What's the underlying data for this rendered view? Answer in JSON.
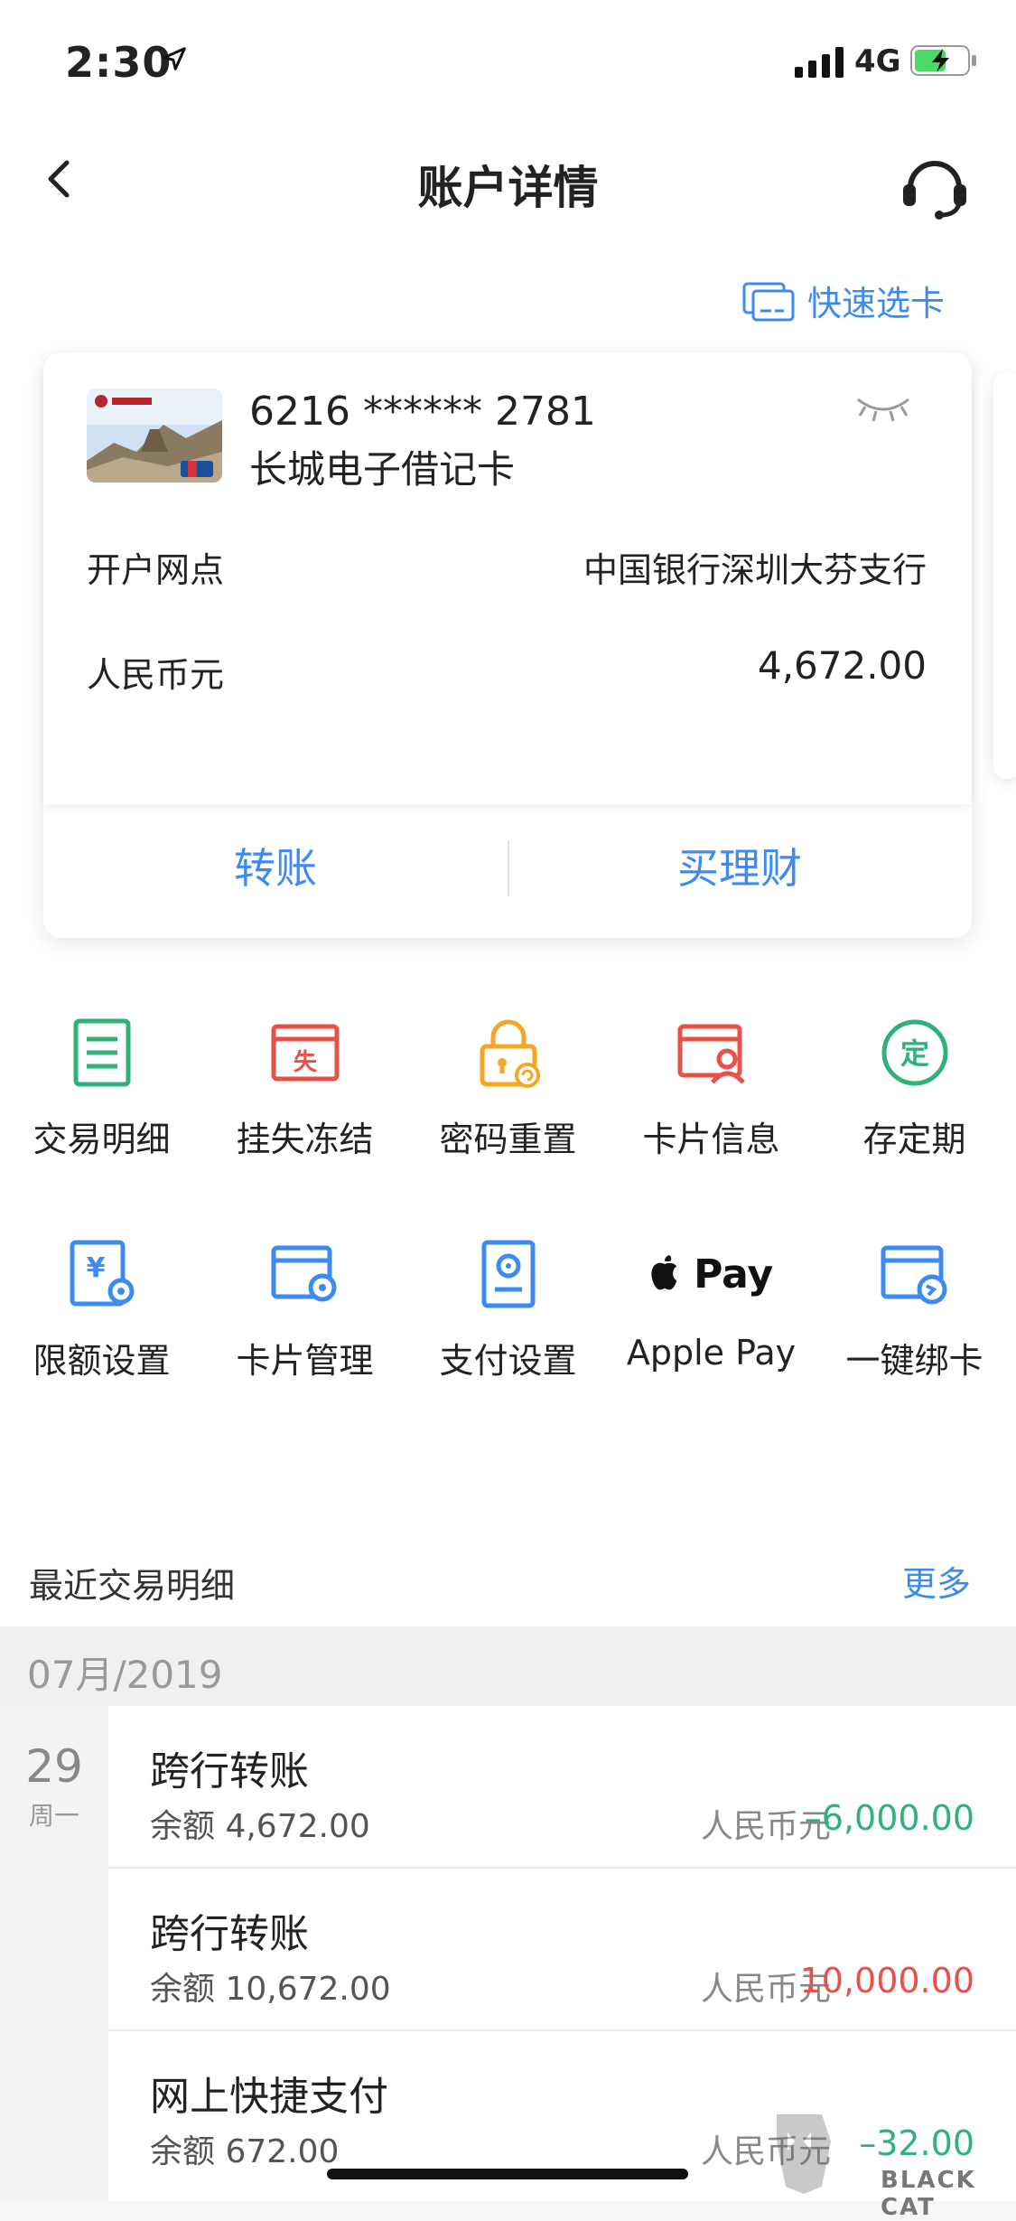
{
  "status": {
    "time": "2:30",
    "network": "4G"
  },
  "nav": {
    "title": "账户详情"
  },
  "quick_select": {
    "label": "快速选卡"
  },
  "card": {
    "number": "6216 ****** 2781",
    "name": "长城电子借记卡",
    "branch_label": "开户网点",
    "branch_value": "中国银行深圳大芬支行",
    "currency_label": "人民币元",
    "balance": "4,672.00",
    "transfer_label": "转账",
    "wealth_label": "买理财"
  },
  "functions": [
    {
      "label": "交易明细",
      "icon": "list-doc-icon",
      "color": "#2fb27a"
    },
    {
      "label": "挂失冻结",
      "icon": "card-loss-icon",
      "color": "#e8504a"
    },
    {
      "label": "密码重置",
      "icon": "lock-reset-icon",
      "color": "#f5a623"
    },
    {
      "label": "卡片信息",
      "icon": "card-user-icon",
      "color": "#e8504a"
    },
    {
      "label": "存定期",
      "icon": "fixed-deposit-icon",
      "color": "#2fb27a"
    },
    {
      "label": "限额设置",
      "icon": "limit-settings-icon",
      "color": "#3d8bf0"
    },
    {
      "label": "卡片管理",
      "icon": "card-manage-icon",
      "color": "#3d8bf0"
    },
    {
      "label": "支付设置",
      "icon": "payment-settings-icon",
      "color": "#3d8bf0"
    },
    {
      "label": "Apple Pay",
      "icon": "apple-pay-icon",
      "logo_text": "Pay",
      "color": "#111111"
    },
    {
      "label": "一键绑卡",
      "icon": "bind-card-icon",
      "color": "#3d8bf0"
    }
  ],
  "recent": {
    "title": "最近交易明细",
    "more": "更多",
    "month": "07月/2019",
    "day": "29",
    "weekday": "周一",
    "transactions": [
      {
        "name": "跨行转账",
        "balance": "余额 4,672.00",
        "currency": "人民币元",
        "amount": "–6,000.00",
        "color": "#2fb27a"
      },
      {
        "name": "跨行转账",
        "balance": "余额 10,672.00",
        "currency": "人民币元",
        "amount": "10,000.00",
        "color": "#e8504a"
      },
      {
        "name": "网上快捷支付",
        "balance": "余额 672.00",
        "currency": "人民币元",
        "amount": "–32.00",
        "color": "#2fb27a"
      }
    ]
  },
  "watermark": {
    "text": "BLACK CAT"
  }
}
